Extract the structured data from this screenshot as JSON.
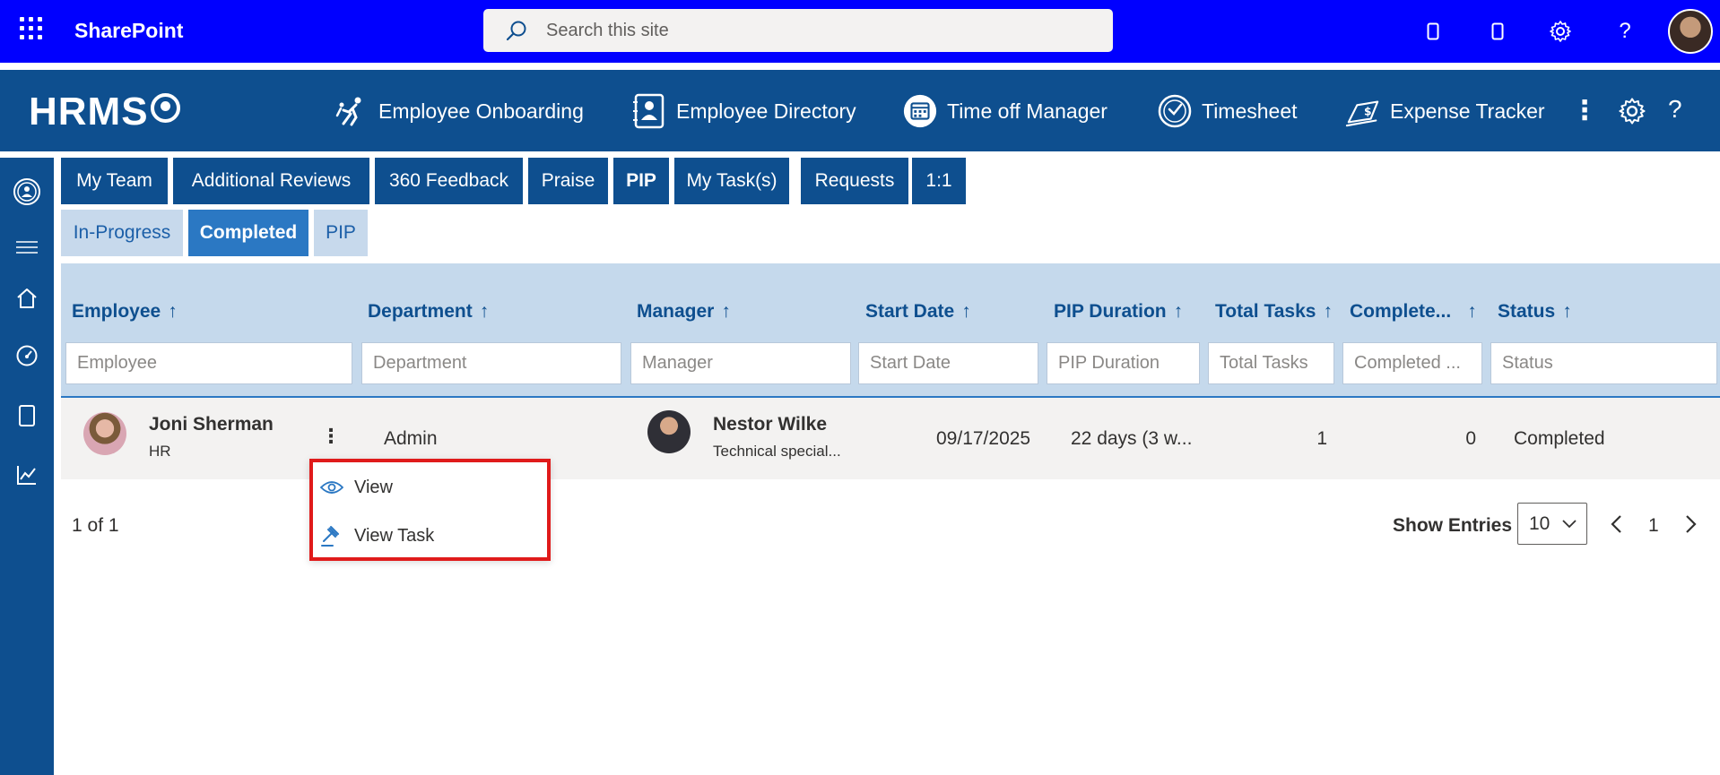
{
  "suitebar": {
    "app_name": "SharePoint",
    "search_placeholder": "Search this site"
  },
  "hrms": {
    "logo_text": "HRMS",
    "nav": [
      {
        "label": "Employee Onboarding",
        "icon": "onboarding-icon"
      },
      {
        "label": "Employee Directory",
        "icon": "directory-icon"
      },
      {
        "label": "Time off Manager",
        "icon": "calendar-icon"
      },
      {
        "label": "Timesheet",
        "icon": "clock-icon"
      },
      {
        "label": "Expense Tracker",
        "icon": "expense-icon"
      }
    ]
  },
  "tabs": [
    "My Team",
    "Additional Reviews",
    "360 Feedback",
    "Praise",
    "PIP",
    "My Task(s)",
    "Requests",
    "1:1"
  ],
  "active_tab": "PIP",
  "subtabs": [
    "In-Progress",
    "Completed",
    "PIP"
  ],
  "active_subtab": "Completed",
  "table": {
    "columns": [
      "Employee",
      "Department",
      "Manager",
      "Start Date",
      "PIP Duration",
      "Total Tasks",
      "Complete...",
      "Status"
    ],
    "sort_arrow": "↑",
    "filters": [
      "Employee",
      "Department",
      "Manager",
      "Start Date",
      "PIP Duration",
      "Total Tasks",
      "Completed ...",
      "Status"
    ],
    "rows": [
      {
        "employee_name": "Joni Sherman",
        "employee_dept_sub": "HR",
        "department": "Admin",
        "manager_name": "Nestor Wilke",
        "manager_title": "Technical special...",
        "start_date": "09/17/2025",
        "pip_duration": "22 days (3 w...",
        "total_tasks": "1",
        "completed": "0",
        "status": "Completed"
      }
    ]
  },
  "row_menu": {
    "dots": "⋮",
    "items": [
      {
        "label": "View",
        "icon": "eye-icon"
      },
      {
        "label": "View Task",
        "icon": "gavel-icon"
      }
    ]
  },
  "pagination": {
    "summary": "1 of 1",
    "show_entries_label": "Show Entries",
    "entries_value": "10",
    "current_page": "1"
  },
  "colors": {
    "suitebar": "#0000ff",
    "brand": "#0e4f8f",
    "subtab_active": "#2b78c3",
    "header_bg": "#c5d9ec",
    "highlight_border": "#e01b1b"
  }
}
